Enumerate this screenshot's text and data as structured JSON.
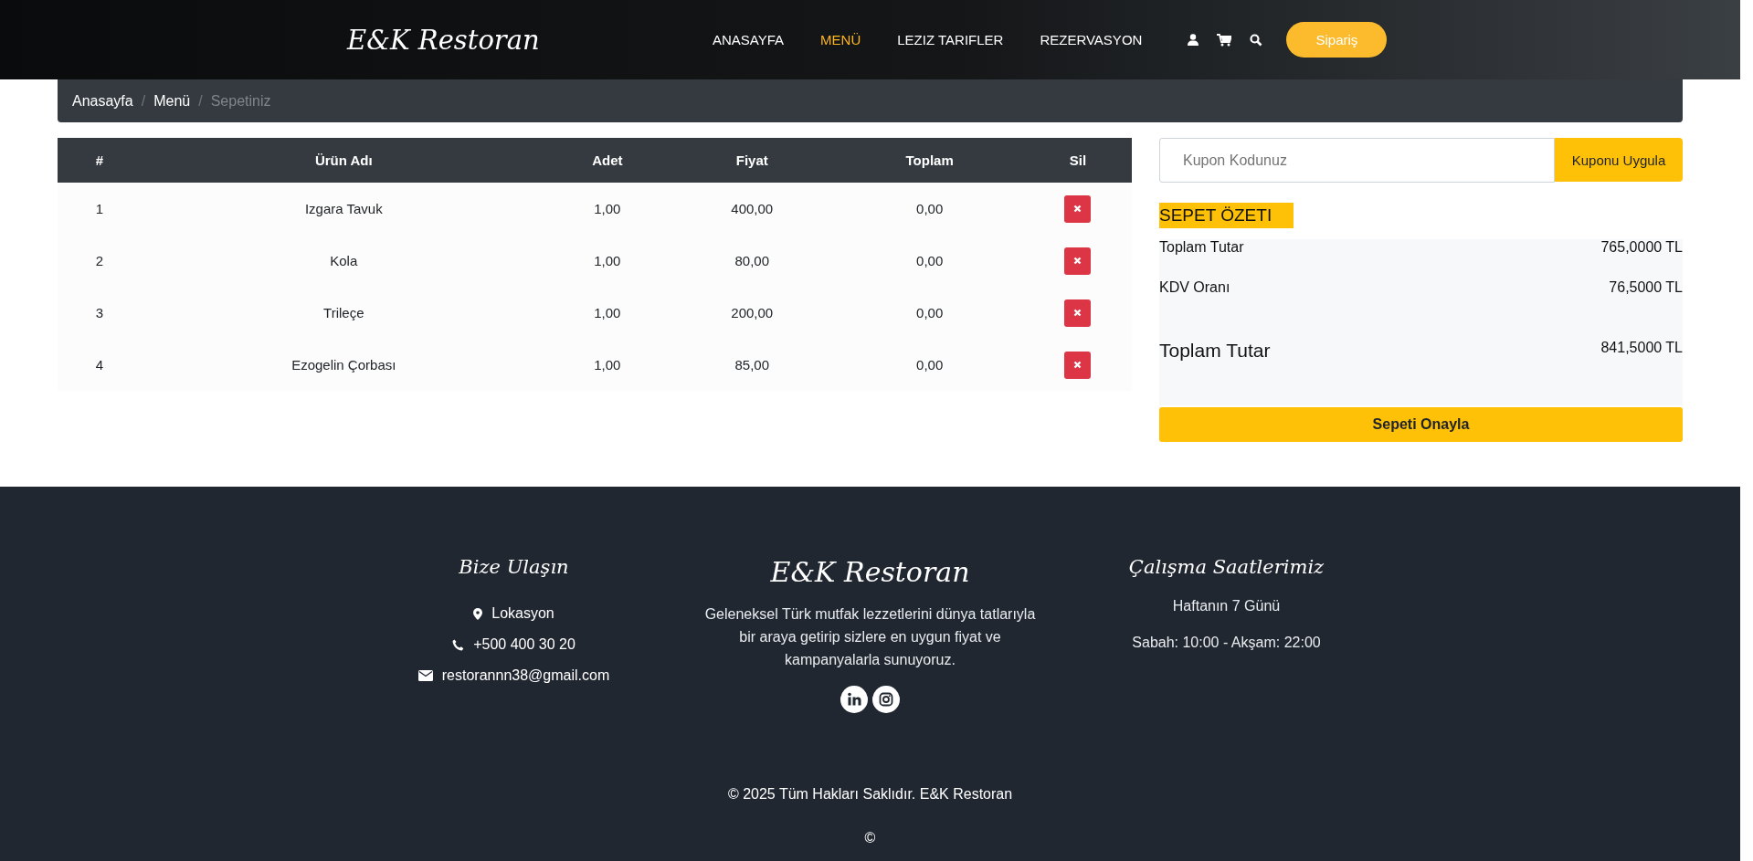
{
  "navbar": {
    "brand": "E&K Restoran",
    "links": [
      {
        "label": "ANASAYFA",
        "selected": false
      },
      {
        "label": "MENÜ",
        "selected": true
      },
      {
        "label": "LEZIZ TARIFLER",
        "selected": false
      },
      {
        "label": "REZERVASYON",
        "selected": false
      }
    ],
    "order_button": "Sipariş"
  },
  "breadcrumb": [
    {
      "label": "Anasayfa",
      "active": false
    },
    {
      "separator": "/",
      "label": "Menü",
      "active": false
    },
    {
      "separator": "/",
      "label": "Sepetiniz",
      "active": true
    }
  ],
  "cart_table": {
    "columns": [
      "#",
      "Ürün Adı",
      "Adet",
      "Fiyat",
      "Toplam",
      "Sil"
    ],
    "rows": [
      {
        "index": "1",
        "name": "Izgara Tavuk",
        "quantity": "1,00",
        "price": "400,00",
        "total": "0,00"
      },
      {
        "index": "2",
        "name": "Kola",
        "quantity": "1,00",
        "price": "80,00",
        "total": "0,00"
      },
      {
        "index": "3",
        "name": "Trileçe",
        "quantity": "1,00",
        "price": "200,00",
        "total": "0,00"
      },
      {
        "index": "4",
        "name": "Ezogelin Çorbası",
        "quantity": "1,00",
        "price": "85,00",
        "total": "0,00"
      }
    ]
  },
  "coupon": {
    "placeholder": "Kupon Kodunuz",
    "button": "Kuponu Uygula"
  },
  "summary": {
    "title": "SEPET ÖZETI",
    "lines": [
      {
        "label": "Toplam Tutar",
        "value": "765,0000 TL",
        "kind": "normal"
      },
      {
        "label": "KDV Oranı",
        "value": "76,5000 TL",
        "kind": "normal"
      },
      {
        "label": "Toplam Tutar",
        "value": "841,5000 TL",
        "kind": "grand"
      }
    ],
    "confirm_button": "Sepeti Onayla"
  },
  "footer": {
    "contact": {
      "title": "Bize Ulaşın",
      "items": [
        {
          "kind": "location",
          "text": "Lokasyon"
        },
        {
          "kind": "phone",
          "text": "+500 400 30 20"
        },
        {
          "kind": "email",
          "text": "restorannn38@gmail.com"
        }
      ]
    },
    "about": {
      "title": "E&K Restoran",
      "text": "Geleneksel Türk mutfak lezzetlerini dünya tatlarıyla bir araya getirip sizlere en uygun fiyat ve kampanyalarla sunuyoruz.",
      "social": [
        {
          "kind": "linkedin"
        },
        {
          "kind": "instagram"
        }
      ]
    },
    "hours": {
      "title": "Çalışma Saatlerimiz",
      "lines": [
        "Haftanın 7 Günü",
        "Sabah: 10:00 - Akşam: 22:00"
      ]
    },
    "copyright": "© 2025 Tüm Hakları Saklıdır. E&K Restoran",
    "mark": "©"
  }
}
